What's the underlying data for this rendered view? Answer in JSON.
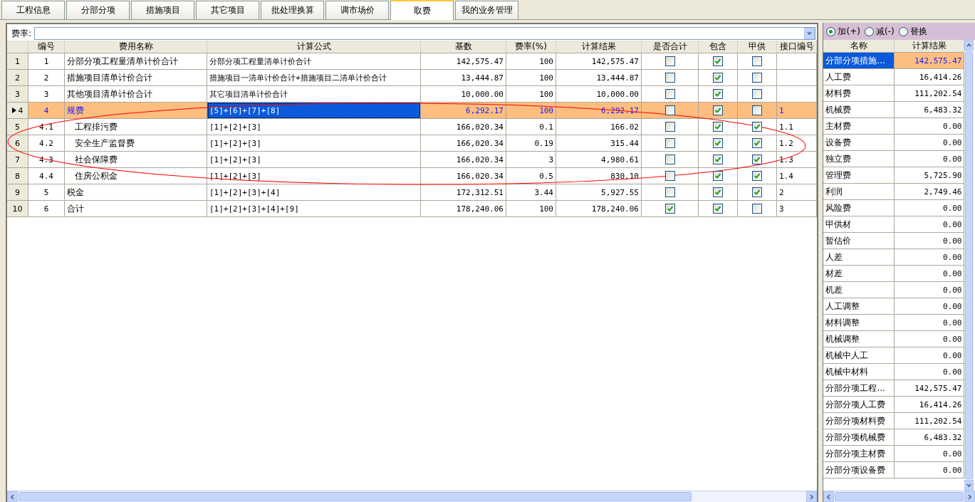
{
  "tabs": [
    {
      "label": "工程信息",
      "selected": false
    },
    {
      "label": "分部分项",
      "selected": false
    },
    {
      "label": "措施项目",
      "selected": false
    },
    {
      "label": "其它项目",
      "selected": false
    },
    {
      "label": "批处理换算",
      "selected": false
    },
    {
      "label": "调市场价",
      "selected": false
    },
    {
      "label": "取费",
      "selected": true
    },
    {
      "label": "我的业务管理",
      "selected": false
    }
  ],
  "rate_field": {
    "label": "费率:"
  },
  "table": {
    "columns": [
      "编号",
      "费用名称",
      "计算公式",
      "基数",
      "费率(%)",
      "计算结果",
      "是否合计",
      "包含",
      "甲供",
      "接口编号"
    ],
    "rows": [
      {
        "row": "1",
        "no": "1",
        "name": "分部分项工程量清单计价合计",
        "formula": "分部分项工程量清单计价合计",
        "base": "142,575.47",
        "rate": "100",
        "result": "142,575.47",
        "summed": false,
        "included": true,
        "supplied": false,
        "code": "",
        "selected": false
      },
      {
        "row": "2",
        "no": "2",
        "name": "措施项目清单计价合计",
        "formula": "措施项目一清单计价合计+措施项目二清单计价合计",
        "base": "13,444.87",
        "rate": "100",
        "result": "13,444.87",
        "summed": false,
        "included": true,
        "supplied": false,
        "code": "",
        "selected": false
      },
      {
        "row": "3",
        "no": "3",
        "name": "其他项目清单计价合计",
        "formula": "其它项目清单计价合计",
        "base": "10,000.00",
        "rate": "100",
        "result": "10,000.00",
        "summed": false,
        "included": true,
        "supplied": false,
        "code": "",
        "selected": false
      },
      {
        "row": "4",
        "no": "4",
        "name": "规费",
        "formula": "[5]+[6]+[7]+[8]",
        "base": "6,292.17",
        "rate": "100",
        "result": "6,292.17",
        "summed": false,
        "included": true,
        "supplied": false,
        "code": "1",
        "selected": true,
        "children": [
          {
            "row": "5",
            "no": "4.1",
            "name": "工程排污费",
            "formula": "[1]+[2]+[3]",
            "base": "166,020.34",
            "rate": "0.1",
            "result": "166.02",
            "summed": false,
            "included": true,
            "supplied": true,
            "code": "1.1",
            "selected": false
          },
          {
            "row": "6",
            "no": "4.2",
            "name": "安全生产监督费",
            "formula": "[1]+[2]+[3]",
            "base": "166,020.34",
            "rate": "0.19",
            "result": "315.44",
            "summed": false,
            "included": true,
            "supplied": true,
            "code": "1.2",
            "selected": false
          },
          {
            "row": "7",
            "no": "4.3",
            "name": "社会保障费",
            "formula": "[1]+[2]+[3]",
            "base": "166,020.34",
            "rate": "3",
            "result": "4,980.61",
            "summed": false,
            "included": true,
            "supplied": true,
            "code": "1.3",
            "selected": false
          },
          {
            "row": "8",
            "no": "4.4",
            "name": "住房公积金",
            "formula": "[1]+[2]+[3]",
            "base": "166,020.34",
            "rate": "0.5",
            "result": "830.10",
            "summed": false,
            "included": true,
            "supplied": true,
            "code": "1.4",
            "selected": false
          }
        ]
      },
      {
        "row": "9",
        "no": "5",
        "name": "税金",
        "formula": "[1]+[2]+[3]+[4]",
        "base": "172,312.51",
        "rate": "3.44",
        "result": "5,927.55",
        "summed": false,
        "included": true,
        "supplied": true,
        "code": "2",
        "selected": false
      },
      {
        "row": "10",
        "no": "6",
        "name": "合计",
        "formula": "[1]+[2]+[3]+[4]+[9]",
        "base": "178,240.06",
        "rate": "100",
        "result": "178,240.06",
        "summed": true,
        "included": true,
        "supplied": false,
        "code": "3",
        "selected": false
      }
    ]
  },
  "side_panel": {
    "modes": [
      {
        "label": "加(+)",
        "selected": true
      },
      {
        "label": "减(-)",
        "selected": false
      },
      {
        "label": "替换",
        "selected": false
      }
    ],
    "columns": [
      "名称",
      "计算结果"
    ],
    "items": [
      {
        "name": "分部分项措施...",
        "value": "142,575.47",
        "selected": true
      },
      {
        "name": "人工费",
        "value": "16,414.26",
        "selected": false
      },
      {
        "name": "材料费",
        "value": "111,202.54",
        "selected": false
      },
      {
        "name": "机械费",
        "value": "6,483.32",
        "selected": false
      },
      {
        "name": "主材费",
        "value": "0.00",
        "selected": false
      },
      {
        "name": "设备费",
        "value": "0.00",
        "selected": false
      },
      {
        "name": "独立费",
        "value": "0.00",
        "selected": false
      },
      {
        "name": "管理费",
        "value": "5,725.90",
        "selected": false
      },
      {
        "name": "利润",
        "value": "2,749.46",
        "selected": false
      },
      {
        "name": "风险费",
        "value": "0.00",
        "selected": false
      },
      {
        "name": "甲供材",
        "value": "0.00",
        "selected": false
      },
      {
        "name": "暂估价",
        "value": "0.00",
        "selected": false
      },
      {
        "name": "人差",
        "value": "0.00",
        "selected": false
      },
      {
        "name": "材差",
        "value": "0.00",
        "selected": false
      },
      {
        "name": "机差",
        "value": "0.00",
        "selected": false
      },
      {
        "name": "人工调整",
        "value": "0.00",
        "selected": false
      },
      {
        "name": "材料调整",
        "value": "0.00",
        "selected": false
      },
      {
        "name": "机械调整",
        "value": "0.00",
        "selected": false
      },
      {
        "name": "机械中人工",
        "value": "0.00",
        "selected": false
      },
      {
        "name": "机械中材料",
        "value": "0.00",
        "selected": false
      },
      {
        "name": "分部分项工程...",
        "value": "142,575.47",
        "selected": false
      },
      {
        "name": "分部分项人工费",
        "value": "16,414.26",
        "selected": false
      },
      {
        "name": "分部分项材料费",
        "value": "111,202.54",
        "selected": false
      },
      {
        "name": "分部分项机械费",
        "value": "6,483.32",
        "selected": false
      },
      {
        "name": "分部分项主材费",
        "value": "0.00",
        "selected": false
      },
      {
        "name": "分部分项设备费",
        "value": "0.00",
        "selected": false
      }
    ]
  }
}
